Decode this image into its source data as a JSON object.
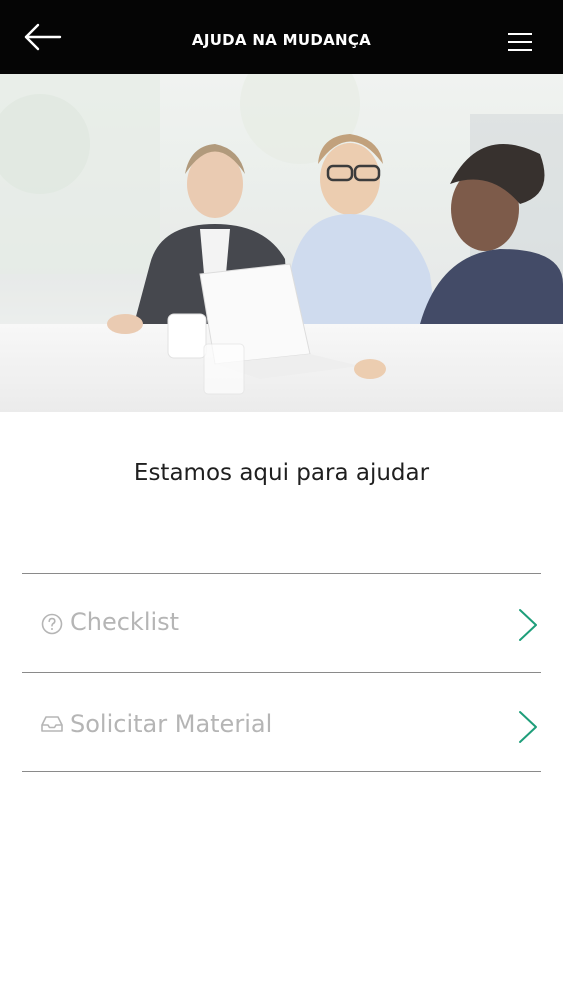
{
  "header": {
    "title": "AJUDA NA MUDANÇA",
    "back_icon": "arrow-left-icon",
    "menu_icon": "hamburger-menu-icon",
    "background": "#050505"
  },
  "hero": {
    "image_alt": "Pessoas sorrindo em reunião com notebook"
  },
  "main": {
    "heading": "Estamos aqui para ajudar",
    "items": [
      {
        "label": "Checklist",
        "icon": "question-circle-icon"
      },
      {
        "label": "Solicitar Material",
        "icon": "inbox-tray-icon"
      }
    ]
  },
  "colors": {
    "accent": "#1e9e7a",
    "item_text": "#b5b5b5",
    "divider": "#8a8a8a"
  }
}
